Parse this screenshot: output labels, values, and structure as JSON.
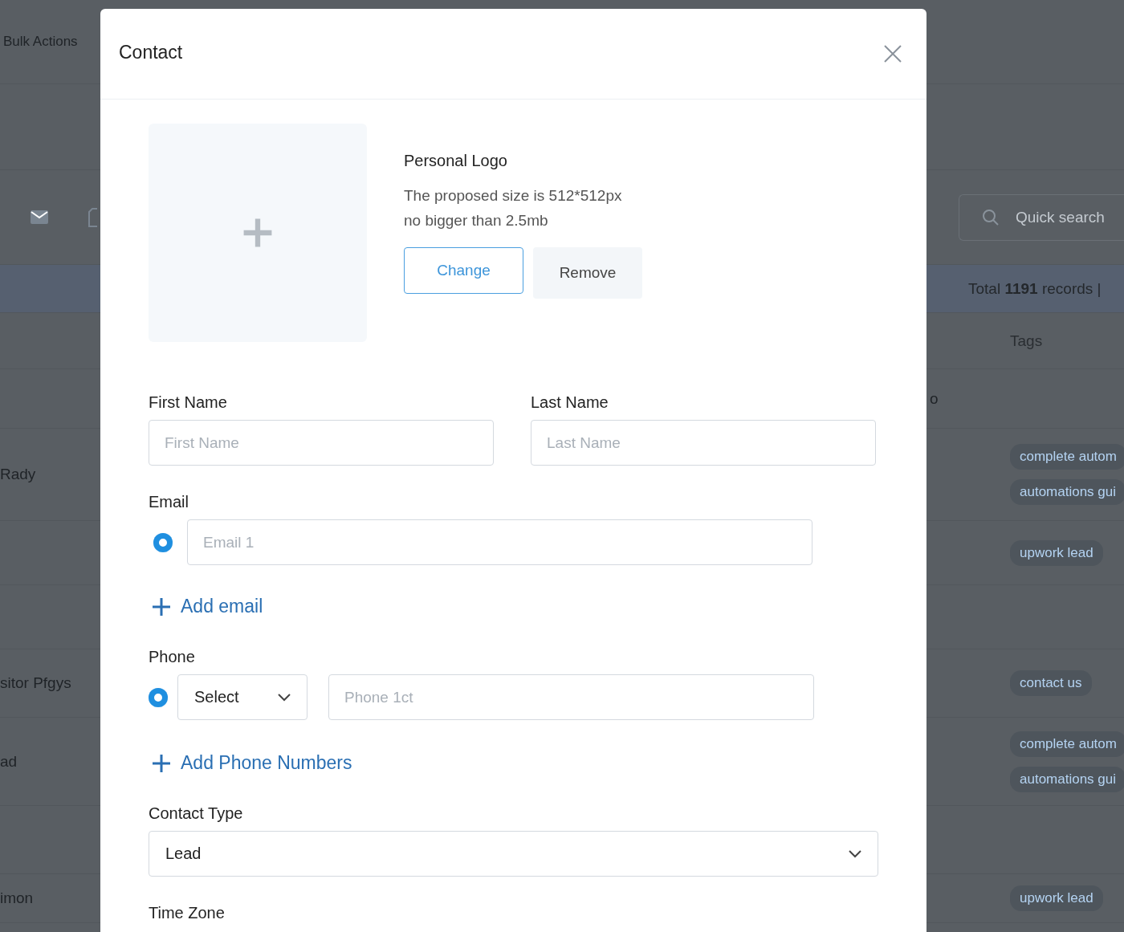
{
  "background": {
    "bulk_actions": "Bulk Actions",
    "search": {
      "placeholder": "Quick search"
    },
    "total_records": "Total **1191** records |",
    "tags_header": "Tags",
    "rows": [
      {
        "left": "",
        "middle": "o",
        "tags": []
      },
      {
        "left": "Rady",
        "middle": "",
        "tags": [
          "complete autom",
          "automations gui"
        ]
      },
      {
        "left": "",
        "middle": "",
        "tags": [
          "upwork lead"
        ]
      },
      {
        "left": "",
        "middle": "",
        "tags": []
      },
      {
        "left": "sitor Pfgys",
        "middle": "",
        "tags": [
          "contact us"
        ]
      },
      {
        "left": "ad",
        "middle": "",
        "tags": [
          "complete autom",
          "automations gui"
        ]
      },
      {
        "left": "",
        "middle": "",
        "tags": []
      },
      {
        "left": "imon",
        "middle": "",
        "tags": [
          "upwork lead"
        ]
      }
    ]
  },
  "modal": {
    "title": "Contact",
    "logo": {
      "title": "Personal Logo",
      "hint_lines": [
        "The proposed size is 512*512px",
        "no bigger than 2.5mb"
      ],
      "buttons": [
        {
          "label": "Change",
          "kind": "primary"
        },
        {
          "label": "Remove",
          "kind": "secondary"
        }
      ]
    },
    "first_name": {
      "label": "First Name",
      "placeholder": "First Name"
    },
    "last_name": {
      "label": "Last Name",
      "placeholder": "Last Name"
    },
    "email": {
      "label": "Email",
      "entries": [
        {
          "placeholder": "Email 1",
          "selected": true
        }
      ],
      "add_label": "Add email"
    },
    "phone": {
      "label": "Phone",
      "entries": [
        {
          "country": "Select",
          "placeholder": "Phone 1ct",
          "selected": true
        }
      ],
      "add_label": "Add Phone Numbers"
    },
    "contact_type": {
      "label": "Contact Type",
      "value": "Lead"
    },
    "time_zone": {
      "label": "Time Zone"
    }
  }
}
